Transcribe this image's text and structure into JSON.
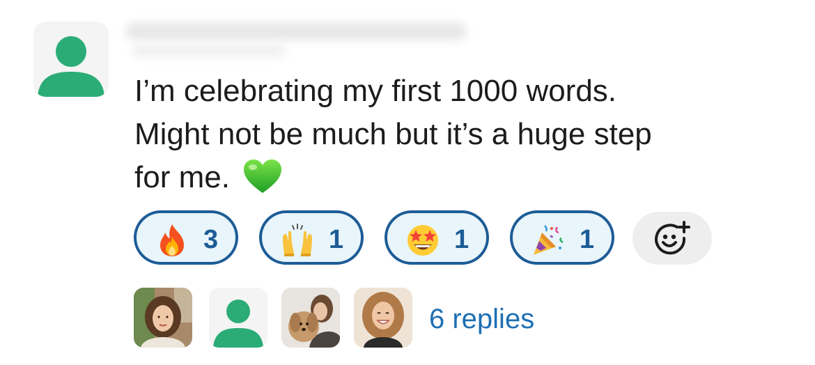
{
  "message": {
    "text_line1": "I’m celebrating my first 1000 words.",
    "text_line2": "Might not be much but it’s a huge step",
    "text_line3": "for me.",
    "inline_emoji": "green-heart-icon"
  },
  "author": {
    "avatar_icon": "user-placeholder-icon",
    "name_blurred": true
  },
  "reactions": [
    {
      "emoji": "fire-icon",
      "count": "3"
    },
    {
      "emoji": "raising-hands-icon",
      "count": "1"
    },
    {
      "emoji": "star-struck-icon",
      "count": "1"
    },
    {
      "emoji": "party-popper-icon",
      "count": "1"
    }
  ],
  "add_reaction": {
    "icon": "add-reaction-icon"
  },
  "thread": {
    "replies_label": "6 replies",
    "avatars": [
      "photo-avatar",
      "user-placeholder-icon",
      "photo-avatar-with-dog",
      "photo-avatar"
    ]
  },
  "colors": {
    "reaction_border": "#1d5c96",
    "reaction_bg": "#e8f5fa",
    "link": "#1d6fb3",
    "placeholder_avatar": "#2bac76"
  }
}
